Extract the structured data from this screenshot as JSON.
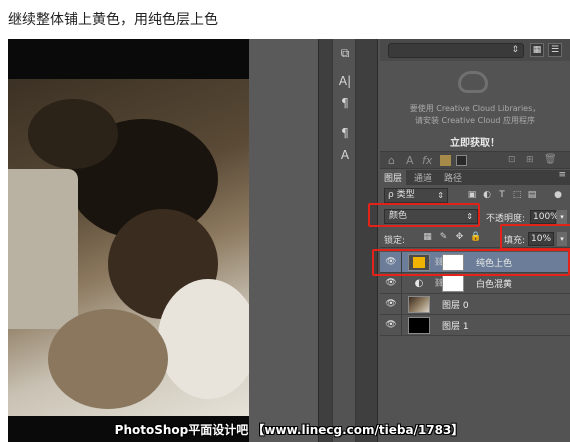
{
  "caption": "继续整体铺上黄色，用纯色层上色",
  "watermark": "PhotoShop平面设计吧 【www.linecg.com/tieba/1783】",
  "toolstrip": {
    "tools": [
      "paragraph-styles-icon",
      "character-icon",
      "paragraph-icon",
      "glyph-icon",
      "text-style-icon"
    ],
    "tool_labels": [
      "⧉",
      "A|",
      "¶",
      "¶",
      "A"
    ]
  },
  "libraries": {
    "message_line1": "要使用 Creative Cloud Libraries，",
    "message_line2": "请安装 Creative Cloud 应用程序",
    "get_now": "立即获取！",
    "bar_icons": [
      "⌂",
      "A",
      "fx",
      "■",
      "■"
    ]
  },
  "layers_panel": {
    "tabs": [
      "图层",
      "通道",
      "路径"
    ],
    "active_tab": "图层",
    "kind_filter": "ρ 类型",
    "blend_mode": "颜色",
    "opacity_label": "不透明度:",
    "opacity_value": "100%",
    "lock_label": "锁定:",
    "fill_label": "填充:",
    "fill_value": "10%",
    "layers": [
      {
        "name": "纯色上色",
        "type": "solid-color",
        "selected": true,
        "fill_color": "#f0b400"
      },
      {
        "name": "白色混黄",
        "type": "adjustment",
        "selected": false
      },
      {
        "name": "图层 0",
        "type": "image",
        "selected": false
      },
      {
        "name": "图层 1",
        "type": "black-fill",
        "selected": false
      }
    ]
  },
  "colors": {
    "highlight_box": "#e2231a",
    "selected_layer": "#6b7d98",
    "yellow_swatch": "#f0b400"
  }
}
